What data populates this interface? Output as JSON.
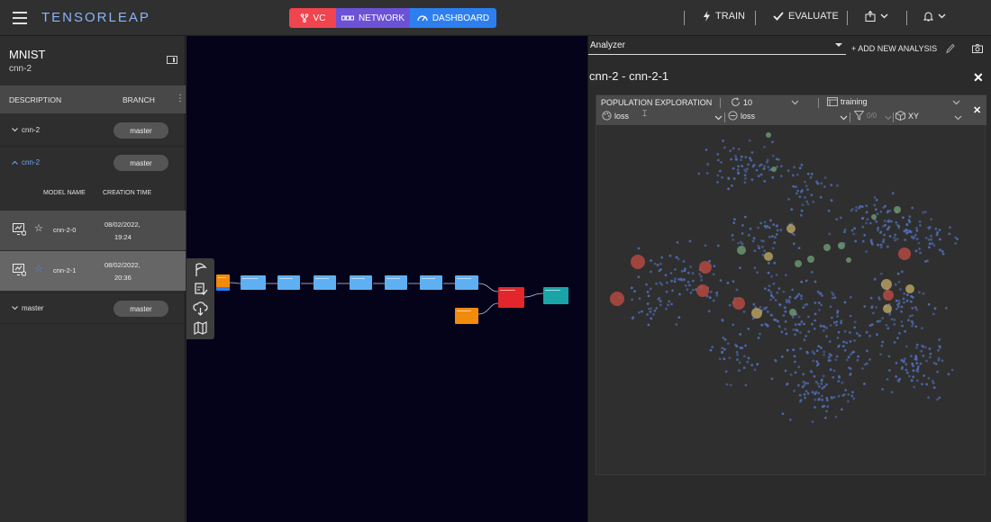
{
  "topbar": {
    "brand": "TENSORLEAP",
    "tabs": {
      "vc": "VC",
      "network": "NETWORK",
      "dashboard": "DASHBOARD"
    },
    "train_label": "TRAIN",
    "evaluate_label": "EVALUATE"
  },
  "sidebar": {
    "project_title": "MNIST",
    "project_subtitle": "cnn-2",
    "headers": {
      "description": "DESCRIPTION",
      "branch": "BRANCH"
    },
    "branches": [
      {
        "name": "cnn-2",
        "branch": "master"
      },
      {
        "name": "cnn-2",
        "branch": "master"
      },
      {
        "name": "master",
        "branch": "master"
      }
    ],
    "model_headers": {
      "name": "MODEL NAME",
      "time": "CREATION TIME"
    },
    "models": [
      {
        "name": "cnn-2-0",
        "date": "08/02/2022,",
        "time": "19:24"
      },
      {
        "name": "cnn-2-1",
        "date": "08/02/2022,",
        "time": "20:36"
      }
    ]
  },
  "analyzer": {
    "select_value": "Analyzer",
    "add_label": "+ ADD NEW ANALYSIS",
    "session_title": "cnn-2 - cnn-2-1",
    "card": {
      "title": "POPULATION EXPLORATION",
      "count": "10",
      "dataset": "training",
      "color_metric": "loss",
      "size_metric": "loss",
      "filter_count": "0/0",
      "projection": "XY"
    }
  },
  "colors": {
    "vc_tab": "#f0444f",
    "network_tab": "#6b52d6",
    "dashboard_tab": "#2d7ff0",
    "node_blue": "#5fb0f3",
    "node_orange": "#f28a0c",
    "node_red": "#e3262b",
    "node_teal": "#19a4a8",
    "point_blue": "#4f6fb8",
    "highlight_red": "#b84a42",
    "highlight_yellow": "#b9a463",
    "highlight_green": "#6c9a72"
  }
}
